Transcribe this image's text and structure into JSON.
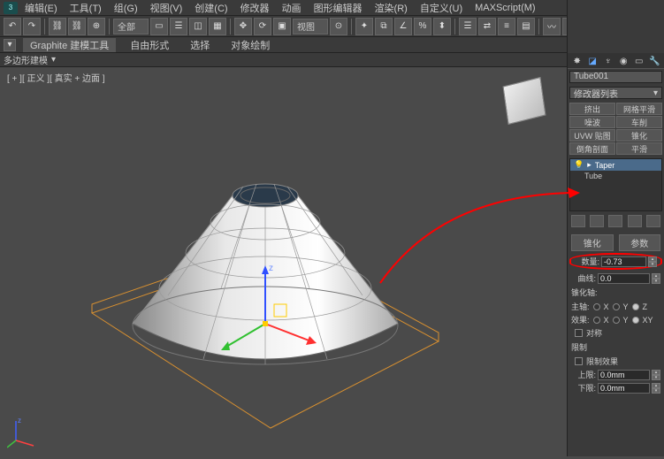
{
  "menu": {
    "items": [
      "编辑(E)",
      "工具(T)",
      "组(G)",
      "视图(V)",
      "创建(C)",
      "修改器",
      "动画",
      "图形编辑器",
      "渲染(R)",
      "自定义(U)",
      "MAXScript(M)"
    ]
  },
  "toolbar": {
    "dropdown1": "全部",
    "viewLabel": "视图"
  },
  "ribbon": {
    "tabs": [
      "Graphite 建模工具",
      "自由形式",
      "选择",
      "对象绘制"
    ],
    "sub": "多边形建模"
  },
  "viewport": {
    "label": "[ + ][ 正义 ][ 真实 + 边面 ]"
  },
  "panel": {
    "objName": "Tube001",
    "modListLabel": "修改器列表",
    "buttons": {
      "b1": "挤出",
      "b2": "网格平滑",
      "b3": "噪波",
      "b4": "车削",
      "b5": "UVW 贴图",
      "b6": "锥化",
      "b7": "倒角剖面",
      "b8": "平滑"
    },
    "stack": {
      "item1": "Taper",
      "item2": "Tube"
    },
    "rollouts": {
      "taperTitle": "锥化",
      "paramTitle": "参数",
      "amountLabel": "数量:",
      "amount": "-0.73",
      "curveLabel": "曲线:",
      "curve": "0.0",
      "axisTitle": "锥化轴:",
      "primaryLabel": "主轴:",
      "effectLabel": "效果:",
      "axisX": "X",
      "axisY": "Y",
      "axisZ": "Z",
      "axisXY": "XY",
      "symmetric": "对称",
      "limitTitle": "限制",
      "limitEffect": "限制效果",
      "upperLabel": "上限:",
      "upper": "0.0mm",
      "lowerLabel": "下限:",
      "lower": "0.0mm"
    }
  }
}
